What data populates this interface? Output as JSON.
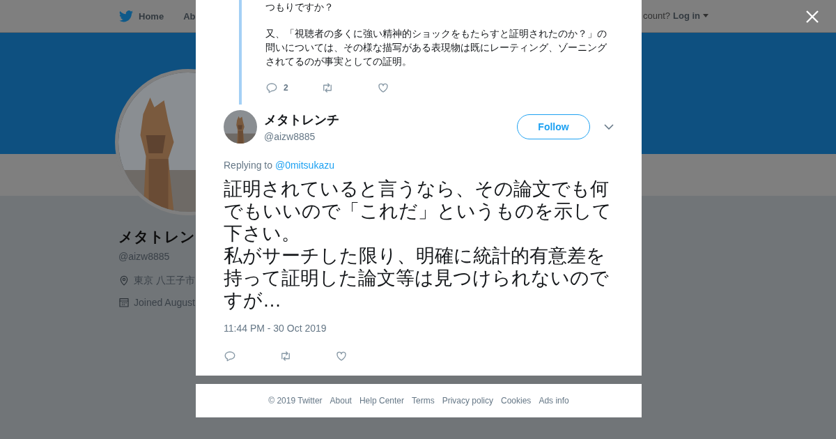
{
  "nav": {
    "home": "Home",
    "about": "Ab",
    "account_prompt": "count?",
    "login": "Log in"
  },
  "profile": {
    "name": "メタトレン",
    "handle": "@aizw8885",
    "location": "東京 八王子市",
    "joined": "Joined August"
  },
  "quoted_tweet": {
    "paragraphs": [
      "つもりですか？",
      "又、「視聴者の多くに強い精神的ショックをもたらすと証明されたのか？」の問いについては、その様な描写がある表現物は既にレーティング、ゾーニングされてるのが事実としての証明。"
    ],
    "reply_count": "2"
  },
  "tweet": {
    "name": "メタトレンチ",
    "handle": "@aizw8885",
    "follow": "Follow",
    "replying_label": "Replying to",
    "replying_to": "@0mitsukazu",
    "text_lines": [
      "証明されていると言うなら、その論文でも何でもいいので「これだ」というものを示して下さい。",
      "私がサーチした限り、明確に統計的有意差を持って証明した論文等は見つけられないのですが…"
    ],
    "time": "11:44 PM - 30 Oct 2019"
  },
  "footer": [
    "© 2019 Twitter",
    "About",
    "Help Center",
    "Terms",
    "Privacy policy",
    "Cookies",
    "Ads info"
  ]
}
